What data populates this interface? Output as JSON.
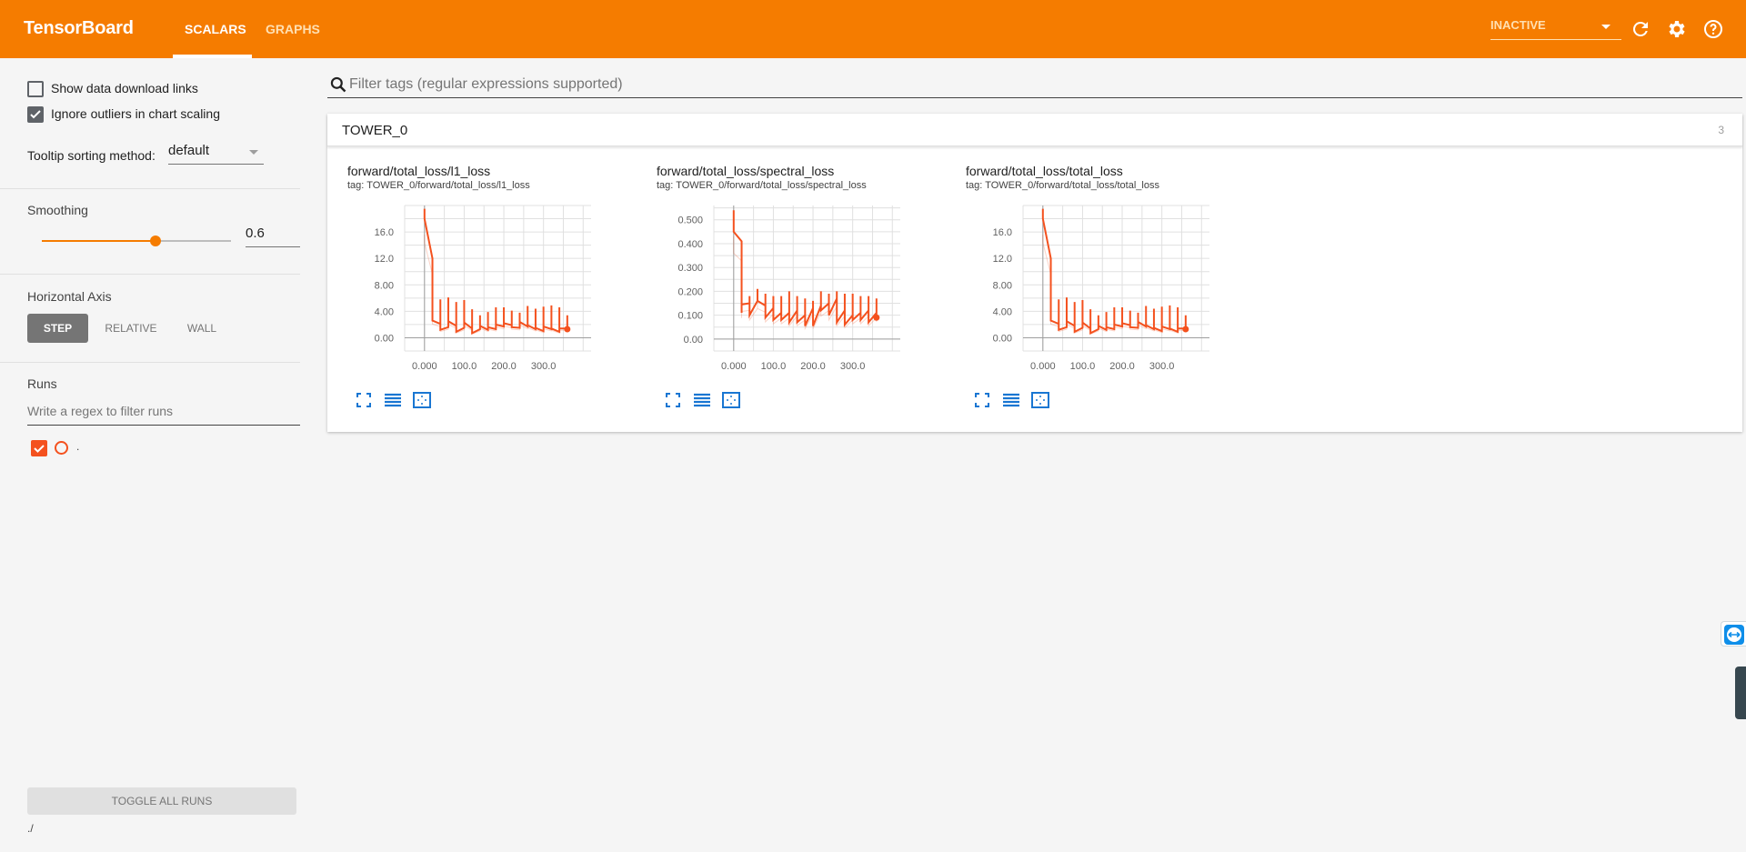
{
  "header": {
    "brand": "TensorBoard",
    "tabs": [
      {
        "label": "SCALARS",
        "active": true
      },
      {
        "label": "GRAPHS",
        "active": false
      }
    ],
    "run_selector": "INACTIVE",
    "icons": [
      "refresh-icon",
      "settings-icon",
      "help-icon"
    ],
    "brand_color": "#f57c00"
  },
  "sidebar": {
    "show_download_links": {
      "label": "Show data download links",
      "checked": false
    },
    "ignore_outliers": {
      "label": "Ignore outliers in chart scaling",
      "checked": true
    },
    "tooltip_sorting": {
      "label": "Tooltip sorting method:",
      "value": "default"
    },
    "smoothing": {
      "label": "Smoothing",
      "value": "0.6",
      "fraction": 0.6
    },
    "horizontal_axis": {
      "label": "Horizontal Axis",
      "options": [
        "STEP",
        "RELATIVE",
        "WALL"
      ],
      "selected": "STEP"
    },
    "runs": {
      "label": "Runs",
      "filter_placeholder": "Write a regex to filter runs",
      "items": [
        {
          "name": ".",
          "checked": true,
          "color": "#f4511e"
        }
      ]
    },
    "toggle_all": "TOGGLE ALL RUNS",
    "data_location": "./"
  },
  "main": {
    "filter_placeholder": "Filter tags (regular expressions supported)",
    "category": {
      "name": "TOWER_0",
      "count": "3"
    }
  },
  "chart_data": [
    {
      "type": "line",
      "title": "forward/total_loss/l1_loss",
      "subtitle": "tag: TOWER_0/forward/total_loss/l1_loss",
      "xlabel": "",
      "ylabel": "",
      "xlim": [
        -50,
        420
      ],
      "ylim": [
        -2,
        20
      ],
      "xticks": [
        "0.000",
        "100.0",
        "200.0",
        "300.0"
      ],
      "xtick_values": [
        0,
        100,
        200,
        300
      ],
      "yticks": [
        "0.00",
        "4.00",
        "8.00",
        "12.0",
        "16.0"
      ],
      "ytick_values": [
        0,
        4,
        8,
        12,
        16
      ],
      "grid": true,
      "series": [
        {
          "name": ".",
          "color": "#f4511e",
          "x": [
            0,
            0,
            20,
            20,
            20,
            40,
            40,
            40,
            60,
            60,
            60,
            80,
            80,
            80,
            100,
            100,
            100,
            120,
            120,
            120,
            140,
            140,
            140,
            160,
            160,
            160,
            180,
            180,
            180,
            200,
            200,
            200,
            220,
            220,
            220,
            240,
            240,
            240,
            260,
            260,
            260,
            280,
            280,
            280,
            300,
            300,
            300,
            320,
            320,
            320,
            340,
            340,
            340,
            360,
            360,
            360
          ],
          "y": [
            19.5,
            18.0,
            12.0,
            6.5,
            2.6,
            2.1,
            5.8,
            1.2,
            1.6,
            6.1,
            2.5,
            1.8,
            5.4,
            0.9,
            1.5,
            5.7,
            2.3,
            1.4,
            4.3,
            0.7,
            1.3,
            3.4,
            1.8,
            1.2,
            3.9,
            1.6,
            1.3,
            4.6,
            2.0,
            1.7,
            4.6,
            2.2,
            1.9,
            4.1,
            1.6,
            1.5,
            3.8,
            2.4,
            1.7,
            4.8,
            1.9,
            1.3,
            4.4,
            1.5,
            1.0,
            4.7,
            1.7,
            1.3,
            4.9,
            1.4,
            0.9,
            4.6,
            1.4,
            1.4,
            3.4,
            1.3
          ]
        }
      ]
    },
    {
      "type": "line",
      "title": "forward/total_loss/spectral_loss",
      "subtitle": "tag: TOWER_0/forward/total_loss/spectral_loss",
      "xlabel": "",
      "ylabel": "",
      "xlim": [
        -50,
        420
      ],
      "ylim": [
        -0.05,
        0.56
      ],
      "xticks": [
        "0.000",
        "100.0",
        "200.0",
        "300.0"
      ],
      "xtick_values": [
        0,
        100,
        200,
        300
      ],
      "yticks": [
        "0.00",
        "0.100",
        "0.200",
        "0.300",
        "0.400",
        "0.500"
      ],
      "ytick_values": [
        0,
        0.1,
        0.2,
        0.3,
        0.4,
        0.5
      ],
      "grid": true,
      "series": [
        {
          "name": ".",
          "color": "#f4511e",
          "x": [
            0,
            0,
            20,
            20,
            20,
            40,
            40,
            40,
            60,
            60,
            60,
            80,
            80,
            80,
            100,
            100,
            100,
            120,
            120,
            120,
            140,
            140,
            140,
            160,
            160,
            160,
            180,
            180,
            180,
            200,
            200,
            200,
            220,
            220,
            220,
            240,
            240,
            240,
            260,
            260,
            260,
            280,
            280,
            280,
            300,
            300,
            300,
            320,
            320,
            320,
            340,
            340,
            340,
            360,
            360,
            360
          ],
          "y": [
            0.54,
            0.45,
            0.41,
            0.11,
            0.145,
            0.15,
            0.18,
            0.1,
            0.16,
            0.21,
            0.16,
            0.14,
            0.19,
            0.09,
            0.13,
            0.18,
            0.08,
            0.11,
            0.18,
            0.08,
            0.11,
            0.2,
            0.07,
            0.12,
            0.18,
            0.07,
            0.1,
            0.17,
            0.055,
            0.13,
            0.16,
            0.055,
            0.14,
            0.2,
            0.12,
            0.15,
            0.19,
            0.1,
            0.17,
            0.2,
            0.07,
            0.12,
            0.19,
            0.06,
            0.1,
            0.19,
            0.08,
            0.11,
            0.18,
            0.08,
            0.12,
            0.18,
            0.07,
            0.11,
            0.17,
            0.09
          ]
        }
      ]
    },
    {
      "type": "line",
      "title": "forward/total_loss/total_loss",
      "subtitle": "tag: TOWER_0/forward/total_loss/total_loss",
      "xlabel": "",
      "ylabel": "",
      "xlim": [
        -50,
        420
      ],
      "ylim": [
        -2,
        20
      ],
      "xticks": [
        "0.000",
        "100.0",
        "200.0",
        "300.0"
      ],
      "xtick_values": [
        0,
        100,
        200,
        300
      ],
      "yticks": [
        "0.00",
        "4.00",
        "8.00",
        "12.0",
        "16.0"
      ],
      "ytick_values": [
        0,
        4,
        8,
        12,
        16
      ],
      "grid": true,
      "series": [
        {
          "name": ".",
          "color": "#f4511e",
          "x": [
            0,
            0,
            20,
            20,
            20,
            40,
            40,
            40,
            60,
            60,
            60,
            80,
            80,
            80,
            100,
            100,
            100,
            120,
            120,
            120,
            140,
            140,
            140,
            160,
            160,
            160,
            180,
            180,
            180,
            200,
            200,
            200,
            220,
            220,
            220,
            240,
            240,
            240,
            260,
            260,
            260,
            280,
            280,
            280,
            300,
            300,
            300,
            320,
            320,
            320,
            340,
            340,
            340,
            360,
            360,
            360
          ],
          "y": [
            19.5,
            18.0,
            12.0,
            6.5,
            2.6,
            2.1,
            5.8,
            1.2,
            1.6,
            6.1,
            2.5,
            1.8,
            5.4,
            0.9,
            1.5,
            5.7,
            2.3,
            1.4,
            4.3,
            0.7,
            1.3,
            3.4,
            1.8,
            1.2,
            3.9,
            1.6,
            1.3,
            4.6,
            2.0,
            1.7,
            4.6,
            2.2,
            1.9,
            4.1,
            1.6,
            1.5,
            3.8,
            2.4,
            1.7,
            4.8,
            1.9,
            1.3,
            4.4,
            1.5,
            1.0,
            4.7,
            1.7,
            1.3,
            4.9,
            1.4,
            0.9,
            4.6,
            1.4,
            1.4,
            3.4,
            1.3
          ]
        }
      ]
    }
  ]
}
